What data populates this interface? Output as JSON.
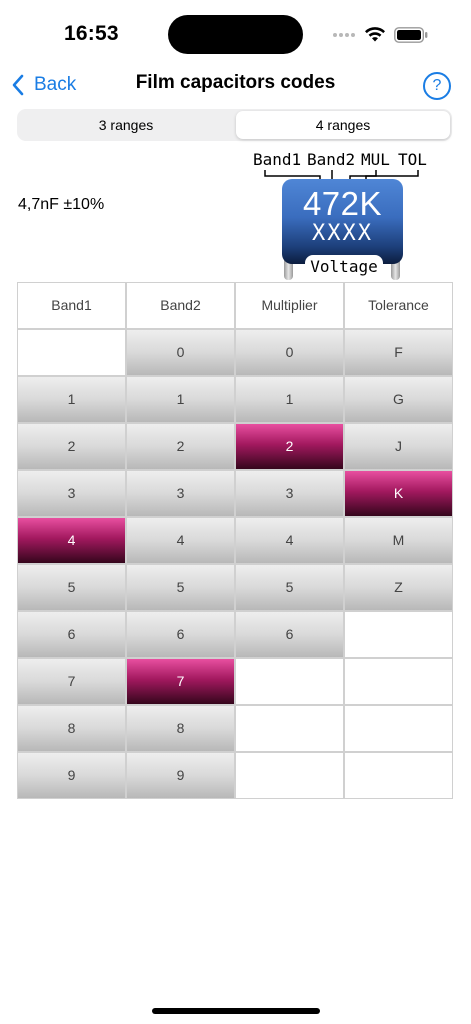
{
  "status": {
    "time": "16:53"
  },
  "nav": {
    "back_label": "Back",
    "title": "Film capacitors codes",
    "help_label": "?"
  },
  "segments": [
    "3 ranges",
    "4 ranges"
  ],
  "selected_segment": "4 ranges",
  "value_text": "4,7nF ±10%",
  "capacitor": {
    "labels": [
      "Band1",
      "Band2",
      "MUL",
      "TOL"
    ],
    "code": "472K",
    "sub_code": "XXXX",
    "voltage_label": "Voltage",
    "body_color": "#3a6dbe"
  },
  "table": {
    "headers": [
      "Band1",
      "Band2",
      "Multiplier",
      "Tolerance"
    ],
    "columns": [
      {
        "values": [
          "",
          "1",
          "2",
          "3",
          "4",
          "5",
          "6",
          "7",
          "8",
          "9"
        ],
        "selected": "4"
      },
      {
        "values": [
          "0",
          "1",
          "2",
          "3",
          "4",
          "5",
          "6",
          "7",
          "8",
          "9"
        ],
        "selected": "7"
      },
      {
        "values": [
          "0",
          "1",
          "2",
          "3",
          "4",
          "5",
          "6",
          "",
          "",
          ""
        ],
        "selected": "2"
      },
      {
        "values": [
          "F",
          "G",
          "J",
          "K",
          "M",
          "Z",
          "",
          "",
          "",
          ""
        ],
        "selected": "K"
      }
    ],
    "selected_color": "#a3195f"
  },
  "colors": {
    "accent": "#1a7de4"
  }
}
